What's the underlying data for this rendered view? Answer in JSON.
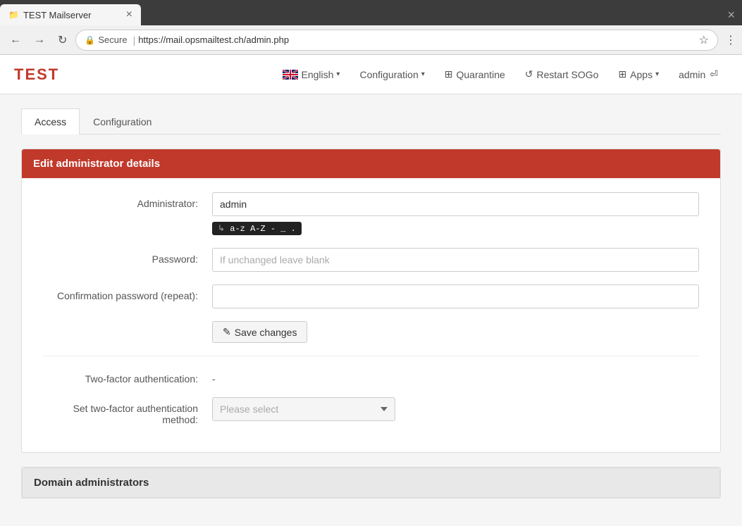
{
  "browser": {
    "tab_favicon": "📁",
    "tab_title": "TEST Mailserver",
    "tab_close": "×",
    "back_btn": "←",
    "forward_btn": "→",
    "reload_btn": "↻",
    "secure_label": "Secure",
    "url": "https://mail.opsmailtest.ch/admin.php",
    "star_btn": "☆",
    "menu_btn": "⋮"
  },
  "navbar": {
    "brand": "TEST",
    "language_label": "English",
    "language_caret": "▾",
    "configuration_label": "Configuration",
    "configuration_caret": "▾",
    "quarantine_label": "Quarantine",
    "restart_sogo_label": "Restart SOGo",
    "apps_label": "Apps",
    "apps_caret": "▾",
    "user_label": "admin",
    "logout_icon": "⏎"
  },
  "tabs": [
    {
      "label": "Access",
      "active": true
    },
    {
      "label": "Configuration",
      "active": false
    }
  ],
  "edit_card": {
    "header": "Edit administrator details",
    "admin_label": "Administrator:",
    "admin_value": "admin",
    "admin_hint": "a-z  A-Z  -  _  .",
    "password_label": "Password:",
    "password_placeholder": "If unchanged leave blank",
    "confirm_label": "Confirmation password (repeat):",
    "save_label": "Save changes",
    "save_icon": "✎",
    "tfa_label": "Two-factor authentication:",
    "tfa_value": "-",
    "set_tfa_label": "Set two-factor authentication method:",
    "select_placeholder": "Please select",
    "select_caret": "▾"
  },
  "domain_admins": {
    "header": "Domain administrators"
  }
}
